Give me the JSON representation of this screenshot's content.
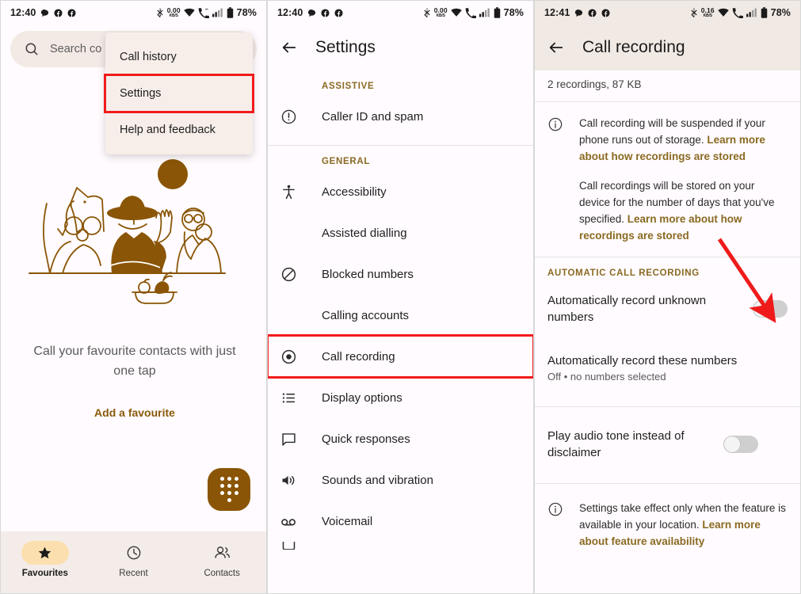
{
  "panel1": {
    "statusbar": {
      "clock": "12:40",
      "battery": "78%",
      "data_rate": "0.00",
      "data_unit": "KB/S",
      "icons": [
        "chat-bubble-icon",
        "facebook-icon",
        "facebook-icon",
        "bluetooth-icon",
        "data-rate-icon",
        "wifi-icon",
        "missed-call-icon",
        "cellular-signal-icon",
        "battery-icon"
      ]
    },
    "search": {
      "placeholder": "Search co"
    },
    "overflow_menu": {
      "items": [
        {
          "label": "Call history",
          "highlighted": false
        },
        {
          "label": "Settings",
          "highlighted": true
        },
        {
          "label": "Help and feedback",
          "highlighted": false
        }
      ]
    },
    "empty_state": {
      "title": "Call your favourite contacts with just one tap",
      "link": "Add a favourite"
    },
    "fab": {
      "name": "dialpad-fab"
    },
    "bottom_nav": [
      {
        "label": "Favourites",
        "icon": "star-icon",
        "active": true
      },
      {
        "label": "Recent",
        "icon": "clock-icon",
        "active": false
      },
      {
        "label": "Contacts",
        "icon": "people-icon",
        "active": false
      }
    ]
  },
  "panel2": {
    "statusbar": {
      "clock": "12:40",
      "battery": "78%",
      "data_rate": "0.00",
      "data_unit": "KB/S"
    },
    "appbar": {
      "title": "Settings",
      "back": "back-arrow-icon"
    },
    "groups": [
      {
        "label": "ASSISTIVE",
        "items": [
          {
            "label": "Caller ID and spam",
            "icon": "exclamation-circle-icon",
            "highlighted": false
          }
        ]
      },
      {
        "label": "GENERAL",
        "items": [
          {
            "label": "Accessibility",
            "icon": "accessibility-icon",
            "highlighted": false
          },
          {
            "label": "Assisted dialling",
            "icon": "none",
            "highlighted": false
          },
          {
            "label": "Blocked numbers",
            "icon": "block-icon",
            "highlighted": false
          },
          {
            "label": "Calling accounts",
            "icon": "none",
            "highlighted": false
          },
          {
            "label": "Call recording",
            "icon": "record-circle-icon",
            "highlighted": true
          },
          {
            "label": "Display options",
            "icon": "list-icon",
            "highlighted": false
          },
          {
            "label": "Quick responses",
            "icon": "message-icon",
            "highlighted": false
          },
          {
            "label": "Sounds and vibration",
            "icon": "volume-icon",
            "highlighted": false
          },
          {
            "label": "Voicemail",
            "icon": "voicemail-icon",
            "highlighted": false
          }
        ]
      }
    ]
  },
  "panel3": {
    "statusbar": {
      "clock": "12:41",
      "battery": "78%",
      "data_rate": "0.16",
      "data_unit": "KB/S"
    },
    "appbar": {
      "title": "Call recording",
      "back": "back-arrow-icon"
    },
    "storage_summary": "2 recordings, 87 KB",
    "info_top": {
      "icon": "info-circle-icon",
      "paragraph1_plain": "Call recording will be suspended if your phone runs out of storage. ",
      "paragraph1_link": "Learn more about how recordings are stored",
      "paragraph2_plain": "Call recordings will be stored on your device for the number of days that you've specified. ",
      "paragraph2_link": "Learn more about how recordings are stored"
    },
    "section_auto": {
      "label": "AUTOMATIC CALL RECORDING",
      "rows": [
        {
          "title": "Automatically record unknown numbers",
          "subtitle": "",
          "toggle": true,
          "toggle_on": false
        },
        {
          "title": "Automatically record these numbers",
          "subtitle": "Off • no numbers selected",
          "toggle": false
        }
      ]
    },
    "section_tone": {
      "rows": [
        {
          "title": "Play audio tone instead of disclaimer",
          "subtitle": "",
          "toggle": true,
          "toggle_on": false
        }
      ]
    },
    "info_bottom": {
      "icon": "info-circle-icon",
      "plain": "Settings take effect only when the feature is available in your location. ",
      "link": "Learn more about feature availability"
    }
  },
  "annotations": {
    "highlight_color": "#f21b1b",
    "arrow_color": "#ef1b1b",
    "accent_brown": "#8a5506",
    "link_color": "#8a6a22"
  }
}
